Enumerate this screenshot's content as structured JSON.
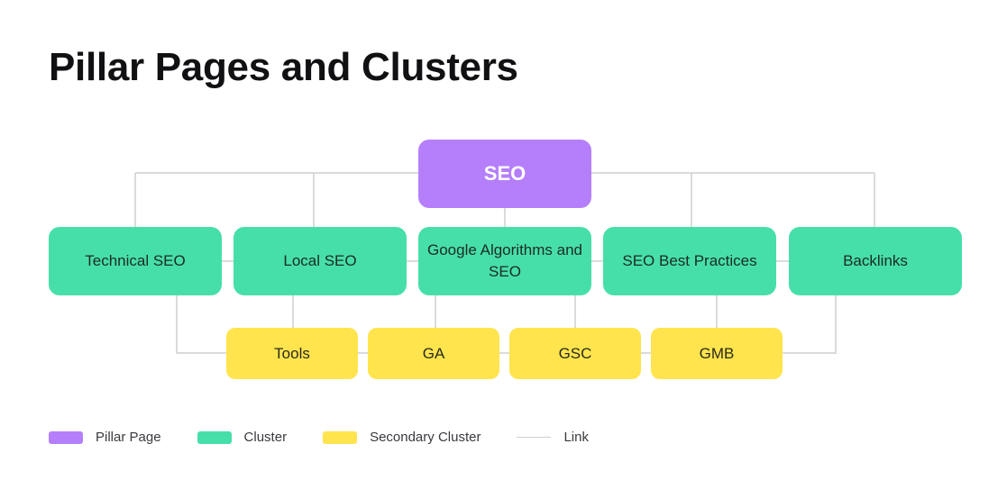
{
  "title": "Pillar Pages and Clusters",
  "colors": {
    "pillar": "#b57ffc",
    "cluster": "#47dfa9",
    "secondary": "#ffe44d",
    "link": "#cfcfd4"
  },
  "pillar": {
    "label": "SEO"
  },
  "clusters": [
    {
      "label": "Technical SEO"
    },
    {
      "label": "Local SEO"
    },
    {
      "label": "Google Algorithms and SEO"
    },
    {
      "label": "SEO Best Practices"
    },
    {
      "label": "Backlinks"
    }
  ],
  "secondary_clusters": [
    {
      "label": "Tools"
    },
    {
      "label": "GA"
    },
    {
      "label": "GSC"
    },
    {
      "label": "GMB"
    }
  ],
  "links": [
    {
      "from": "SEO",
      "to": "Technical SEO"
    },
    {
      "from": "SEO",
      "to": "Local SEO"
    },
    {
      "from": "SEO",
      "to": "Google Algorithms and SEO"
    },
    {
      "from": "SEO",
      "to": "SEO Best Practices"
    },
    {
      "from": "SEO",
      "to": "Backlinks"
    },
    {
      "from": "Technical SEO",
      "to": "Local SEO"
    },
    {
      "from": "Local SEO",
      "to": "Google Algorithms and SEO"
    },
    {
      "from": "Google Algorithms and SEO",
      "to": "SEO Best Practices"
    },
    {
      "from": "SEO Best Practices",
      "to": "Backlinks"
    },
    {
      "from": "Technical SEO",
      "to": "Tools"
    },
    {
      "from": "Local SEO",
      "to": "Tools"
    },
    {
      "from": "Google Algorithms and SEO",
      "to": "GA"
    },
    {
      "from": "Google Algorithms and SEO",
      "to": "GSC"
    },
    {
      "from": "SEO Best Practices",
      "to": "GMB"
    },
    {
      "from": "Backlinks",
      "to": "GMB"
    },
    {
      "from": "Tools",
      "to": "GA"
    },
    {
      "from": "GA",
      "to": "GSC"
    },
    {
      "from": "GSC",
      "to": "GMB"
    }
  ],
  "legend": [
    {
      "label": "Pillar Page",
      "kind": "pillar"
    },
    {
      "label": "Cluster",
      "kind": "cluster"
    },
    {
      "label": "Secondary Cluster",
      "kind": "secondary"
    },
    {
      "label": "Link",
      "kind": "link"
    }
  ]
}
